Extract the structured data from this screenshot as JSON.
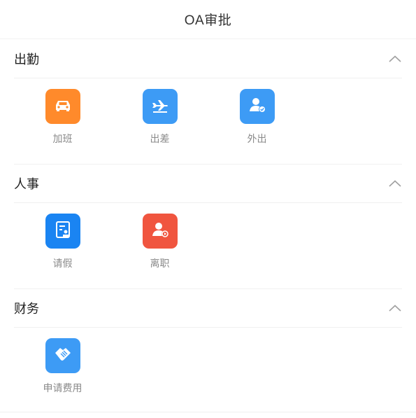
{
  "header": {
    "title": "OA审批"
  },
  "sections": [
    {
      "title": "出勤",
      "toggle_icon": "chevron-up-icon",
      "items": [
        {
          "label": "加班",
          "icon": "car-icon",
          "color": "#ff8a2b"
        },
        {
          "label": "出差",
          "icon": "airplane-icon",
          "color": "#3d9bf5"
        },
        {
          "label": "外出",
          "icon": "user-check-icon",
          "color": "#3d9bf5"
        }
      ]
    },
    {
      "title": "人事",
      "toggle_icon": "chevron-up-icon",
      "items": [
        {
          "label": "请假",
          "icon": "leave-form-icon",
          "color": "#1a84f2"
        },
        {
          "label": "离职",
          "icon": "user-exit-icon",
          "color": "#f0553f"
        }
      ]
    },
    {
      "title": "财务",
      "toggle_icon": "chevron-up-icon",
      "items": [
        {
          "label": "申请费用",
          "icon": "handshake-icon",
          "color": "#3d9bf5"
        }
      ]
    }
  ]
}
